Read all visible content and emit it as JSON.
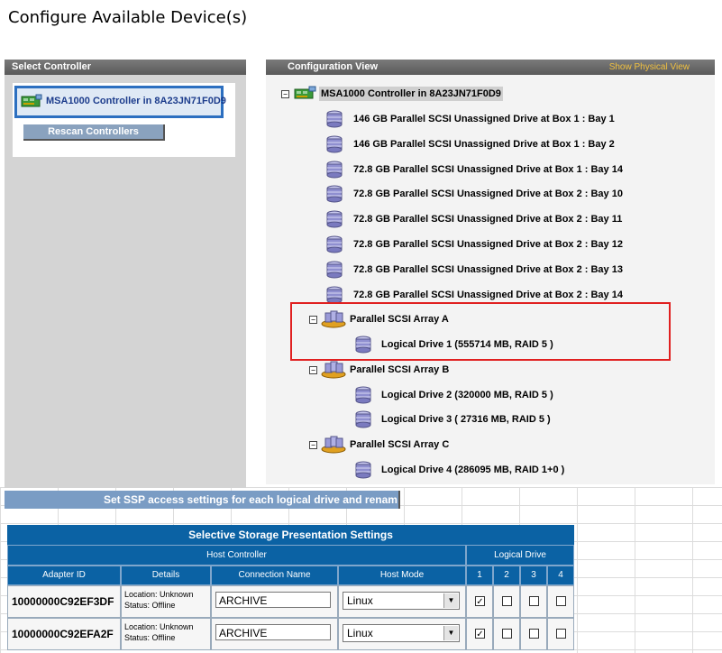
{
  "page": {
    "title": "Configure Available Device(s)"
  },
  "select_controller": {
    "header": "Select Controller",
    "controller_label": "MSA1000 Controller in 8A23JN71F0D9",
    "rescan_label": "Rescan Controllers"
  },
  "config_view": {
    "header": "Configuration View",
    "show_physical": "Show Physical View",
    "root": "MSA1000 Controller in 8A23JN71F0D9",
    "unassigned": [
      "146 GB Parallel SCSI Unassigned Drive at Box 1 : Bay 1",
      "146 GB Parallel SCSI Unassigned Drive at Box 1 : Bay 2",
      "72.8 GB Parallel SCSI Unassigned Drive at Box 1 : Bay 14",
      "72.8 GB Parallel SCSI Unassigned Drive at Box 2 : Bay 10",
      "72.8 GB Parallel SCSI Unassigned Drive at Box 2 : Bay 11",
      "72.8 GB Parallel SCSI Unassigned Drive at Box 2 : Bay 12",
      "72.8 GB Parallel SCSI Unassigned Drive at Box 2 : Bay 13",
      "72.8 GB Parallel SCSI Unassigned Drive at Box 2 : Bay 14"
    ],
    "arrays": [
      {
        "name": "Parallel SCSI Array A",
        "drives": [
          "Logical Drive 1 (555714 MB, RAID 5 )"
        ]
      },
      {
        "name": "Parallel SCSI Array B",
        "drives": [
          "Logical Drive 2 (320000 MB, RAID 5 )",
          "Logical Drive 3 ( 27316 MB, RAID 5 )"
        ]
      },
      {
        "name": "Parallel SCSI Array C",
        "drives": [
          "Logical Drive 4 (286095 MB, RAID 1+0 )"
        ]
      }
    ],
    "expander_symbol": "⊟"
  },
  "ssp": {
    "banner": "Set SSP access settings for each logical drive and renam",
    "title": "Selective Storage Presentation Settings",
    "group_host": "Host Controller",
    "group_logical": "Logical Drive",
    "col_adapter": "Adapter ID",
    "col_details": "Details",
    "col_connection": "Connection Name",
    "col_mode": "Host Mode",
    "drive_cols": [
      "1",
      "2",
      "3",
      "4"
    ],
    "rows": [
      {
        "adapter": "10000000C92EF3DF",
        "location": "Location: Unknown",
        "status": "Status: Offline",
        "connection": "ARCHIVE",
        "mode": "Linux",
        "checks": [
          true,
          false,
          false,
          false
        ]
      },
      {
        "adapter": "10000000C92EFA2F",
        "location": "Location: Unknown",
        "status": "Status: Offline",
        "connection": "ARCHIVE",
        "mode": "Linux",
        "checks": [
          true,
          false,
          false,
          false
        ]
      }
    ],
    "check_mark": "✓",
    "dropdown_arrow": "▼"
  },
  "colors": {
    "accent": "#0b62a4",
    "highlight": "#e02020",
    "selection": "#2c6fc0"
  },
  "icons": {
    "controller": "controller-icon",
    "disk": "disk-icon",
    "array": "array-icon"
  }
}
